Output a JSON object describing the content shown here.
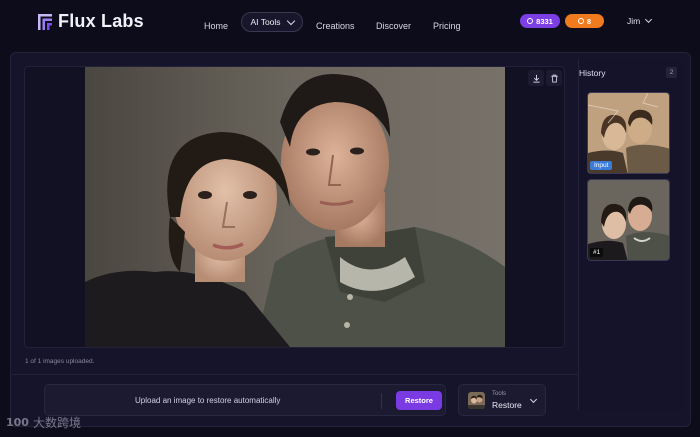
{
  "app": {
    "name": "Flux Labs"
  },
  "nav": {
    "home": "Home",
    "ai_tools": "AI Tools",
    "creations": "Creations",
    "discover": "Discover",
    "pricing": "Pricing"
  },
  "credits": {
    "primary": "8331",
    "secondary": "8",
    "primary_color": "#7b3fe4",
    "secondary_color": "#f07a1e"
  },
  "user": {
    "name": "Jim"
  },
  "canvas": {
    "upload_status": "1 of 1 images uploaded."
  },
  "history": {
    "title": "History",
    "count": "2",
    "items": [
      {
        "tag": "Input"
      },
      {
        "tag": "#1"
      }
    ]
  },
  "prompt_bar": {
    "text": "Upload an image to restore automatically",
    "action_label": "Restore"
  },
  "tools_selector": {
    "label": "Tools",
    "value": "Restore"
  },
  "watermark": {
    "mark": "100",
    "text": "大数跨境"
  },
  "icons": {
    "download": "download-icon",
    "delete": "trash-icon",
    "chevron": "chevron-down-icon",
    "coin": "coin-icon"
  }
}
